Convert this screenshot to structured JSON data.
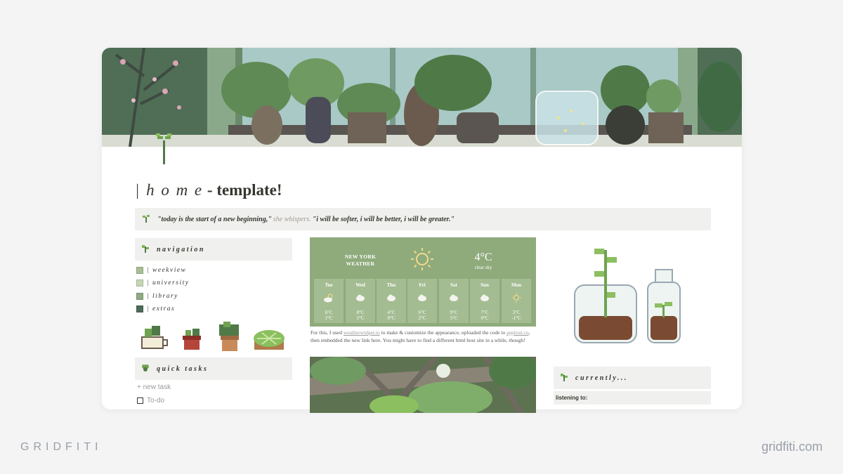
{
  "page": {
    "title_prefix": "| h o m e",
    "title_suffix": " - template!",
    "quote": {
      "part1": "\"today is the start of a new beginning,\"",
      "part2": "she whispers.",
      "part3": "\"i will be softer, i will be better, i will be greater.\""
    }
  },
  "navigation": {
    "heading": "navigation",
    "items": [
      {
        "label": "| weekview",
        "color": "#a8bf95"
      },
      {
        "label": "| university",
        "color": "#c4d6b4"
      },
      {
        "label": "| library",
        "color": "#8eaa84"
      },
      {
        "label": "| extras",
        "color": "#4d6b58"
      }
    ]
  },
  "quick_tasks": {
    "heading": "quick tasks",
    "new_task": "+ new task",
    "todo_label": "To-do"
  },
  "weather": {
    "city_line1": "NEW YORK",
    "city_line2": "WEATHER",
    "temp": "4°C",
    "desc": "clear sky",
    "days": [
      {
        "name": "Tue",
        "icon": "partly-cloudy-icon",
        "high": "6°C",
        "low": "1°C"
      },
      {
        "name": "Wed",
        "icon": "cloud-icon",
        "high": "8°C",
        "low": "1°C"
      },
      {
        "name": "Thu",
        "icon": "cloud-icon",
        "high": "4°C",
        "low": "0°C"
      },
      {
        "name": "Fri",
        "icon": "cloud-icon",
        "high": "6°C",
        "low": "2°C"
      },
      {
        "name": "Sat",
        "icon": "cloud-icon",
        "high": "9°C",
        "low": "5°C"
      },
      {
        "name": "Sun",
        "icon": "cloud-icon",
        "high": "7°C",
        "low": "0°C"
      },
      {
        "name": "Mon",
        "icon": "sun-icon",
        "high": "3°C",
        "low": "-1°C"
      }
    ],
    "note_before": "For this, I used ",
    "note_link1": "weatherwidget.io",
    "note_mid1": " to make & customize the appearance,  uploaded the code to ",
    "note_link2": "apption.co",
    "note_after": ", then embedded the new link here. You might have to find a different html host site in a while, though!"
  },
  "currently": {
    "heading": "currently...",
    "listening_label": "listening to:"
  },
  "footer": {
    "brand_left": "GRIDFITI",
    "brand_right": "gridfiti.com"
  },
  "colors": {
    "weather_bg": "#8fab7c",
    "callout_bg": "#f0f0ee",
    "page_bg": "#f4f4f4"
  }
}
